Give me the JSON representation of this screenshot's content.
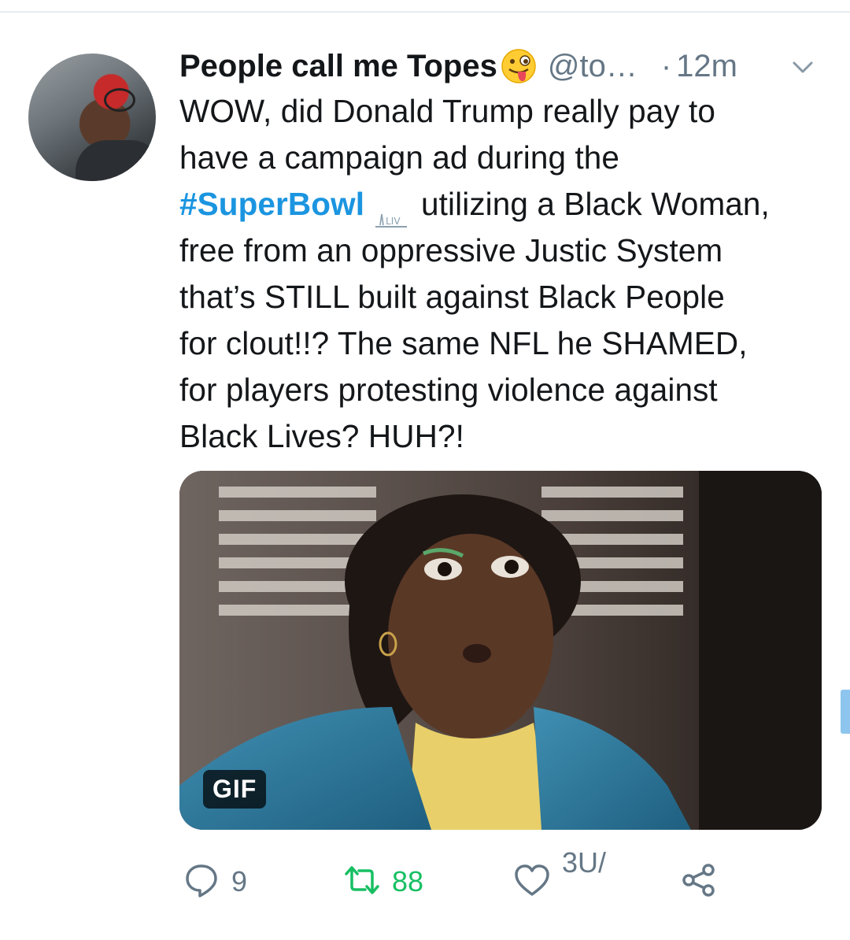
{
  "tweet": {
    "author": {
      "display_name": "People call me Topes",
      "emoji": "zany-face-emoji",
      "handle": "@to…",
      "separator": "·",
      "time": "12m"
    },
    "text_lines": [
      "WOW, did Donald Trump really pay to",
      "have a campaign ad during the",
      "utilizing a Black Woman,",
      "free from an oppressive Justic System",
      "that’s STILL built against Black People",
      "for clout!!? The same NFL he SHAMED,",
      "for players protesting violence against",
      "Black Lives? HUH?!"
    ],
    "hashtag": "#SuperBowl",
    "hashtag_logo_text": "LIV",
    "media": {
      "type": "gif",
      "badge": "GIF"
    },
    "actions": {
      "reply_count": "9",
      "retweet_count": "88",
      "like_count": "307",
      "like_count_display": "3U/"
    }
  },
  "colors": {
    "text": "#14171a",
    "secondary": "#657786",
    "link": "#1b95e0",
    "retweet_active": "#17bf63",
    "divider": "#e6ecf0"
  },
  "icons": [
    "chevron-down-icon",
    "reply-icon",
    "retweet-icon",
    "like-icon",
    "share-icon"
  ]
}
